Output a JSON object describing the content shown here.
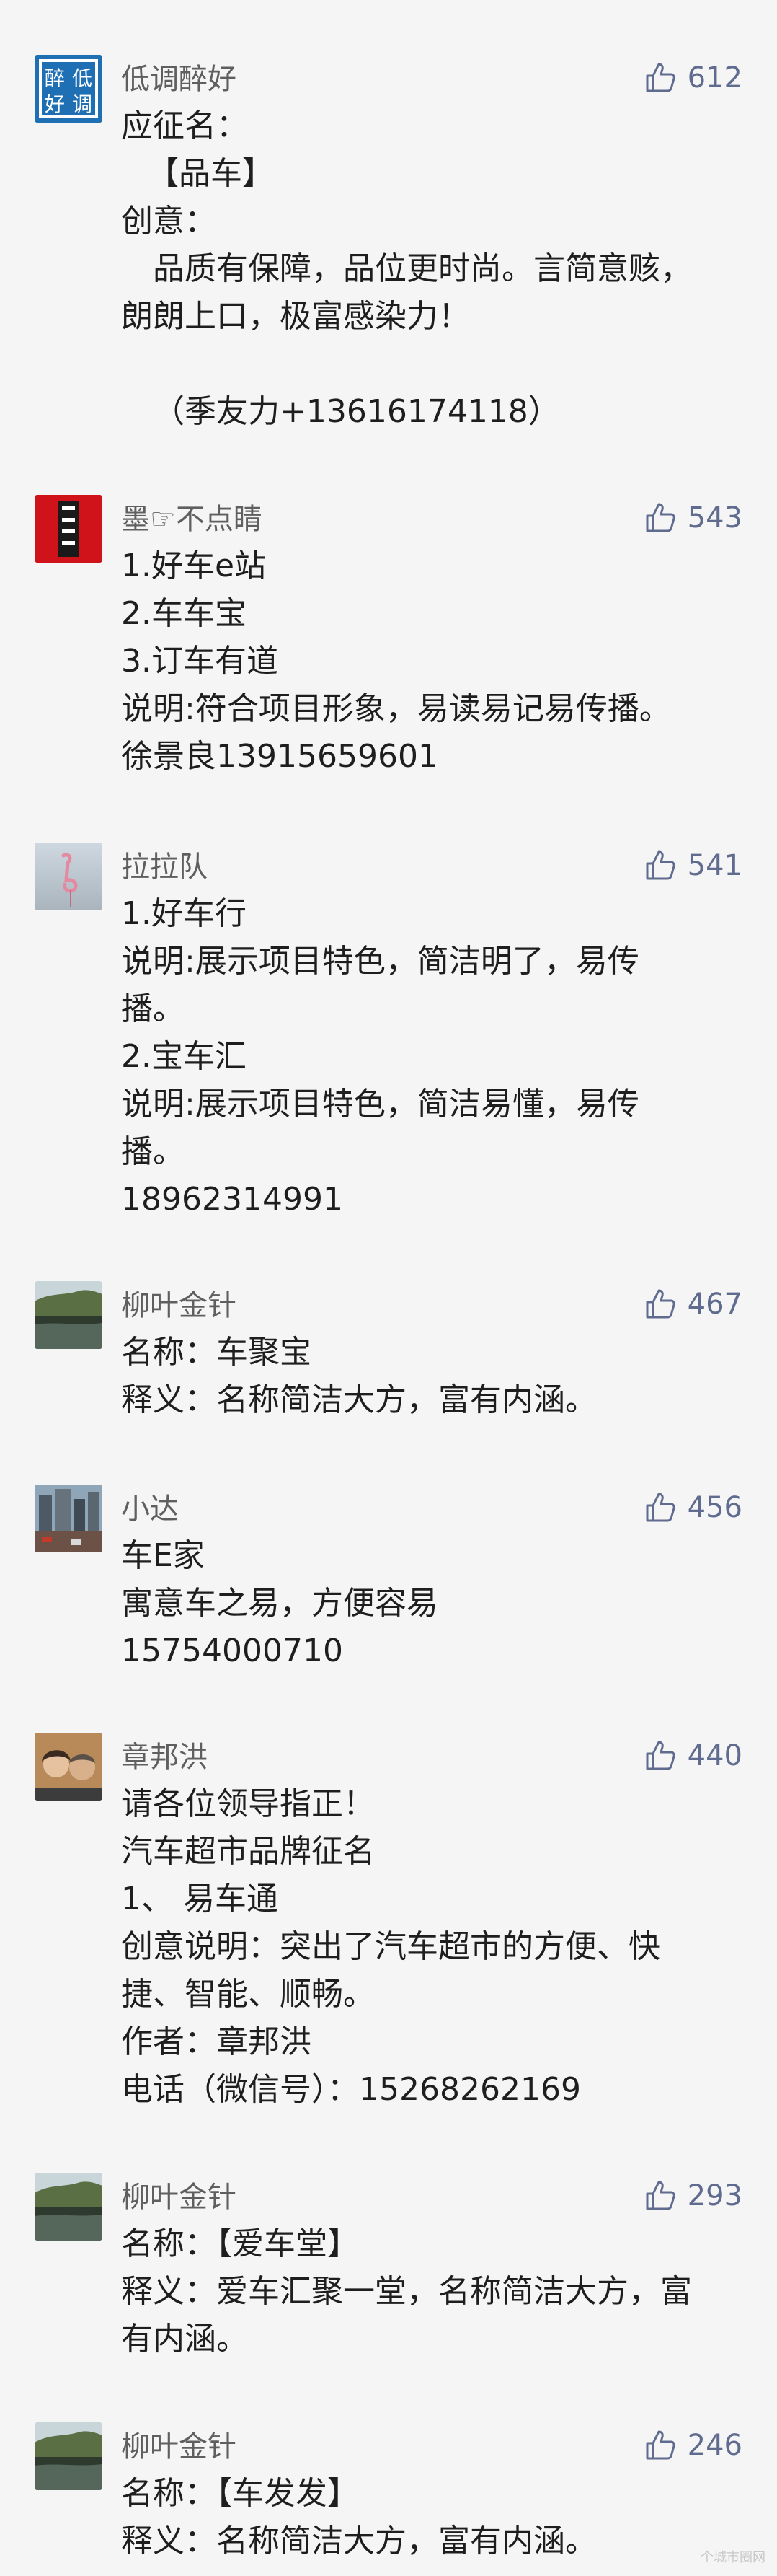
{
  "comments": [
    {
      "nickname": "低调醉好",
      "likes": "612",
      "avatar_icon": "calligraphy-logo-avatar",
      "avatar_chars": [
        "醉",
        "低",
        "好",
        "调"
      ],
      "lines": [
        "应征名：",
        "【品车】",
        "创意：",
        "品质有保障，品位更时尚。言简意赅，",
        "朗朗上口，极富感染力！",
        "",
        "（季友力+13616174118）"
      ]
    },
    {
      "nickname": "墨☞不点睛",
      "likes": "543",
      "avatar_icon": "red-seal-avatar",
      "lines": [
        "1.好车e站",
        "2.车车宝",
        "3.订车有道",
        "说明:符合项目形象，易读易记易传播。",
        "徐景良13915659601"
      ]
    },
    {
      "nickname": "拉拉队",
      "likes": "541",
      "avatar_icon": "flamingo-photo-avatar",
      "lines": [
        "1.好车行",
        "说明:展示项目特色，简洁明了，易传",
        "播。",
        "2.宝车汇",
        "说明:展示项目特色，简洁易懂，易传",
        "播。",
        "18962314991"
      ]
    },
    {
      "nickname": "柳叶金针",
      "likes": "467",
      "avatar_icon": "landscape-photo-avatar",
      "lines": [
        "名称：车聚宝",
        "释义：名称简洁大方，富有内涵。"
      ]
    },
    {
      "nickname": "小达",
      "likes": "456",
      "avatar_icon": "city-photo-avatar",
      "lines": [
        "车E家",
        "寓意车之易，方便容易",
        "15754000710"
      ]
    },
    {
      "nickname": "章邦洪",
      "likes": "440",
      "avatar_icon": "couple-photo-avatar",
      "lines": [
        "请各位领导指正！",
        "汽车超市品牌征名",
        "1、 易车通",
        "创意说明：突出了汽车超市的方便、快",
        "捷、智能、顺畅。",
        "作者：章邦洪",
        "电话（微信号）：15268262169"
      ]
    },
    {
      "nickname": "柳叶金针",
      "likes": "293",
      "avatar_icon": "landscape-photo-avatar",
      "lines": [
        "名称：【爱车堂】",
        "释义：爱车汇聚一堂，名称简洁大方，富",
        "有内涵。"
      ]
    },
    {
      "nickname": "柳叶金针",
      "likes": "246",
      "avatar_icon": "landscape-photo-avatar",
      "lines": [
        "名称：【车发发】",
        "释义：名称简洁大方，富有内涵。"
      ]
    }
  ],
  "watermark": "个城市圈网",
  "colors": {
    "background": "#f5f5f5",
    "text": "#1e1e1e",
    "nickname": "#5f5f5f",
    "like": "#5f6c8f"
  }
}
